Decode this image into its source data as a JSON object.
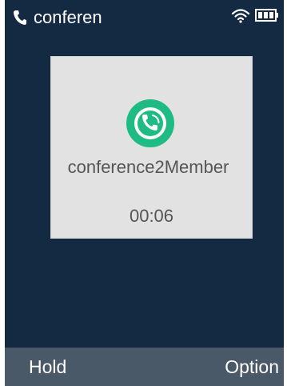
{
  "status_bar": {
    "title": "conferen",
    "call_icon": "phone-handset-icon",
    "wifi_icon": "wifi-icon",
    "battery_icon": "battery-icon"
  },
  "call_card": {
    "icon": "phone-call-icon",
    "name": "conference2Member",
    "timer": "00:06"
  },
  "softkeys": {
    "left": "Hold",
    "right": "Option"
  },
  "colors": {
    "background": "#142a43",
    "card": "#e2e2e2",
    "accent": "#1fbb84",
    "softkey_bar": "#4a5967"
  }
}
